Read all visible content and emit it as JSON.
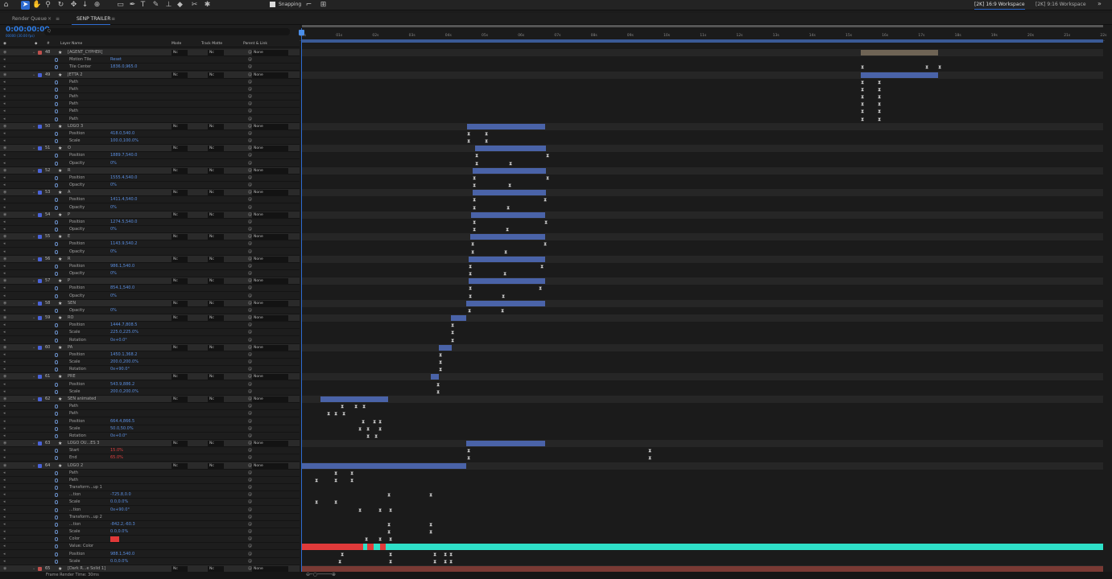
{
  "toolbar": {
    "snapping_label": "Snapping",
    "workspace_1": "[2K] 16:9 Workspace",
    "workspace_2": "[2K] 9:16 Workspace"
  },
  "tabs": [
    {
      "label": "Render Queue"
    },
    {
      "label": "SENP TRAILER"
    }
  ],
  "timecode": "0:00:00:00",
  "fps": "00000 (30.00 fps)",
  "search_placeholder": "Q",
  "columns": {
    "layer_name": "Layer Name",
    "mode": "Mode",
    "track_matte": "Track Matte",
    "parent": "Parent & Link"
  },
  "ruler": [
    "00s",
    "01s",
    "02s",
    "03s",
    "04s",
    "05s",
    "06s",
    "07s",
    "08s",
    "09s",
    "10s",
    "11s",
    "12s",
    "13s",
    "14s",
    "15s",
    "16s",
    "17s",
    "18s",
    "19s",
    "20s",
    "21s",
    "22s"
  ],
  "rows": [
    {
      "kind": "layer",
      "num": "48",
      "name": "[AGENT_CYPHER]",
      "mode": "Nc",
      "tm": "Nc",
      "parent": "None"
    },
    {
      "kind": "prop",
      "name": "Motion Tile",
      "value": "Reset"
    },
    {
      "kind": "prop",
      "name": "Tile Center",
      "value": "1836.0,965.0"
    },
    {
      "kind": "layer",
      "num": "49",
      "name": "JETTA 2",
      "mode": "Nc",
      "tm": "Nc",
      "parent": "None"
    },
    {
      "kind": "prop",
      "name": "Path",
      "value": ""
    },
    {
      "kind": "prop",
      "name": "Path",
      "value": ""
    },
    {
      "kind": "prop",
      "name": "Path",
      "value": ""
    },
    {
      "kind": "prop",
      "name": "Path",
      "value": ""
    },
    {
      "kind": "prop",
      "name": "Path",
      "value": ""
    },
    {
      "kind": "prop",
      "name": "Path",
      "value": ""
    },
    {
      "kind": "layer",
      "num": "50",
      "name": "LOGO 3",
      "mode": "Nc",
      "tm": "Nc",
      "parent": "None"
    },
    {
      "kind": "prop",
      "name": "Position",
      "value": "418.0,540.0"
    },
    {
      "kind": "prop",
      "name": "Scale",
      "value": "100.0,100.0%"
    },
    {
      "kind": "layer",
      "num": "51",
      "name": "O",
      "mode": "Nc",
      "tm": "Nc",
      "parent": "None"
    },
    {
      "kind": "prop",
      "name": "Position",
      "value": "1889.7,540.0"
    },
    {
      "kind": "prop",
      "name": "Opacity",
      "value": "0%"
    },
    {
      "kind": "layer",
      "num": "52",
      "name": "R",
      "mode": "Nc",
      "tm": "Nc",
      "parent": "None"
    },
    {
      "kind": "prop",
      "name": "Position",
      "value": "1555.4,540.0"
    },
    {
      "kind": "prop",
      "name": "Opacity",
      "value": "0%"
    },
    {
      "kind": "layer",
      "num": "53",
      "name": "A",
      "mode": "Nc",
      "tm": "Nc",
      "parent": "None"
    },
    {
      "kind": "prop",
      "name": "Position",
      "value": "1411.4,540.0"
    },
    {
      "kind": "prop",
      "name": "Opacity",
      "value": "0%"
    },
    {
      "kind": "layer",
      "num": "54",
      "name": "P",
      "mode": "Nc",
      "tm": "Nc",
      "parent": "None"
    },
    {
      "kind": "prop",
      "name": "Position",
      "value": "1274.5,540.0"
    },
    {
      "kind": "prop",
      "name": "Opacity",
      "value": "0%"
    },
    {
      "kind": "layer",
      "num": "55",
      "name": "E",
      "mode": "Nc",
      "tm": "Nc",
      "parent": "None"
    },
    {
      "kind": "prop",
      "name": "Position",
      "value": "1143.9,540.2"
    },
    {
      "kind": "prop",
      "name": "Opacity",
      "value": "0%"
    },
    {
      "kind": "layer",
      "num": "56",
      "name": "R",
      "mode": "Nc",
      "tm": "Nc",
      "parent": "None"
    },
    {
      "kind": "prop",
      "name": "Position",
      "value": "986.1,540.0"
    },
    {
      "kind": "prop",
      "name": "Opacity",
      "value": "0%"
    },
    {
      "kind": "layer",
      "num": "57",
      "name": "P",
      "mode": "Nc",
      "tm": "Nc",
      "parent": "None"
    },
    {
      "kind": "prop",
      "name": "Position",
      "value": "854.1,540.0"
    },
    {
      "kind": "prop",
      "name": "Opacity",
      "value": "0%"
    },
    {
      "kind": "layer",
      "num": "58",
      "name": "SEN",
      "mode": "Nc",
      "tm": "Nc",
      "parent": "None"
    },
    {
      "kind": "prop",
      "name": "Opacity",
      "value": "0%"
    },
    {
      "kind": "layer",
      "num": "59",
      "name": "RO",
      "mode": "Nc",
      "tm": "Nc",
      "parent": "None"
    },
    {
      "kind": "prop",
      "name": "Position",
      "value": "1444.7,808.5"
    },
    {
      "kind": "prop",
      "name": "Scale",
      "value": "225.0,225.0%"
    },
    {
      "kind": "prop",
      "name": "Rotation",
      "value": "0x+0.0°"
    },
    {
      "kind": "layer",
      "num": "60",
      "name": "PA",
      "mode": "Nc",
      "tm": "Nc",
      "parent": "None"
    },
    {
      "kind": "prop",
      "name": "Position",
      "value": "1450.1,368.2"
    },
    {
      "kind": "prop",
      "name": "Scale",
      "value": "200.0,200.0%"
    },
    {
      "kind": "prop",
      "name": "Rotation",
      "value": "0x+90.0°"
    },
    {
      "kind": "layer",
      "num": "61",
      "name": "PRE",
      "mode": "Nc",
      "tm": "Nc",
      "parent": "None"
    },
    {
      "kind": "prop",
      "name": "Position",
      "value": "543.9,886.2"
    },
    {
      "kind": "prop",
      "name": "Scale",
      "value": "200.0,200.0%"
    },
    {
      "kind": "layer",
      "num": "62",
      "name": "SEN animated",
      "mode": "Nc",
      "tm": "Nc",
      "parent": "None"
    },
    {
      "kind": "prop",
      "name": "Path",
      "value": ""
    },
    {
      "kind": "prop",
      "name": "Path",
      "value": ""
    },
    {
      "kind": "prop",
      "name": "Position",
      "value": "664.4,866.5"
    },
    {
      "kind": "prop",
      "name": "Scale",
      "value": "50.0,50.0%"
    },
    {
      "kind": "prop",
      "name": "Rotation",
      "value": "0x+0.0°"
    },
    {
      "kind": "layer",
      "num": "63",
      "name": "LOGO OU...ES 3",
      "mode": "Nc",
      "tm": "Nc",
      "parent": "None"
    },
    {
      "kind": "prop",
      "name": "Start",
      "value": "15.0%",
      "red": true
    },
    {
      "kind": "prop",
      "name": "End",
      "value": "65.0%",
      "red": true
    },
    {
      "kind": "layer",
      "num": "64",
      "name": "LOGO 2",
      "mode": "Nc",
      "tm": "Nc",
      "parent": "None"
    },
    {
      "kind": "prop",
      "name": "Path",
      "value": ""
    },
    {
      "kind": "prop",
      "name": "Path",
      "value": ""
    },
    {
      "kind": "prop",
      "name": "Transform...up 1",
      "value": ""
    },
    {
      "kind": "prop",
      "name": "...tion",
      "value": "-725.8,0.0"
    },
    {
      "kind": "prop",
      "name": "Scale",
      "value": "0.0,0.0%"
    },
    {
      "kind": "prop",
      "name": "...tion",
      "value": "0x+90.0°"
    },
    {
      "kind": "prop",
      "name": "Transform...up 2",
      "value": ""
    },
    {
      "kind": "prop",
      "name": "...tion",
      "value": "-842.2,-60.3"
    },
    {
      "kind": "prop",
      "name": "Scale",
      "value": "0.0,0.0%"
    },
    {
      "kind": "prop",
      "name": "Color",
      "value": ""
    },
    {
      "kind": "prop",
      "name": "Value: Color",
      "value": ""
    },
    {
      "kind": "prop",
      "name": "Position",
      "value": "988.1,540.0"
    },
    {
      "kind": "prop",
      "name": "Scale",
      "value": "0.0,0.0%"
    },
    {
      "kind": "layer",
      "num": "65",
      "name": "[Dark R...e Solid 1]",
      "mode": "Nc",
      "tm": "Nc",
      "parent": "None"
    }
  ],
  "status": {
    "render_time": "Frame Render Time: 30ms"
  }
}
